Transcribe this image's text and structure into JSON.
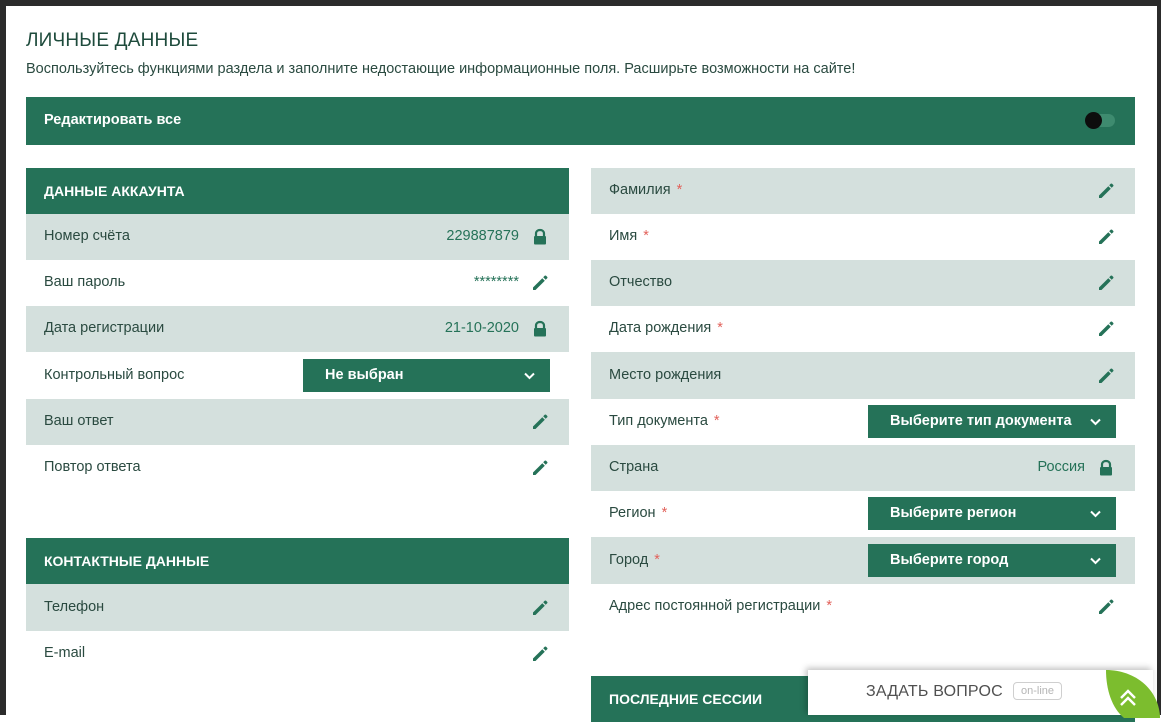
{
  "header": {
    "title": "ЛИЧНЫЕ ДАННЫЕ",
    "subtitle": "Воспользуйтесь функциями раздела и заполните недостающие информационные поля. Расширьте возможности на сайте!"
  },
  "edit_all": {
    "label": "Редактировать все",
    "enabled": false
  },
  "account": {
    "title": "ДАННЫЕ АККАУНТА",
    "account_number": {
      "label": "Номер счёта",
      "value": "229887879",
      "icon": "lock-icon"
    },
    "password": {
      "label": "Ваш пароль",
      "value": "********",
      "icon": "pencil-icon"
    },
    "registration_date": {
      "label": "Дата регистрации",
      "value": "21-10-2020",
      "icon": "lock-icon"
    },
    "security_question": {
      "label": "Контрольный вопрос",
      "selected": "Не выбран"
    },
    "answer": {
      "label": "Ваш ответ",
      "icon": "pencil-icon"
    },
    "answer_repeat": {
      "label": "Повтор ответа",
      "icon": "pencil-icon"
    }
  },
  "contacts": {
    "title": "КОНТАКТНЫЕ ДАННЫЕ",
    "phone": {
      "label": "Телефон",
      "icon": "pencil-icon"
    },
    "email": {
      "label": "E-mail",
      "icon": "pencil-icon"
    }
  },
  "personal": {
    "surname": {
      "label": "Фамилия",
      "required": "*"
    },
    "name": {
      "label": "Имя",
      "required": "*"
    },
    "patronymic": {
      "label": "Отчество"
    },
    "birth_date": {
      "label": "Дата рождения",
      "required": "*"
    },
    "birth_place": {
      "label": "Место рождения"
    },
    "doc_type": {
      "label": "Тип документа",
      "required": "*",
      "selected": "Выберите тип документа"
    },
    "country": {
      "label": "Страна",
      "value": "Россия",
      "icon": "lock-icon"
    },
    "region": {
      "label": "Регион",
      "required": "*",
      "selected": "Выберите регион"
    },
    "city": {
      "label": "Город",
      "required": "*",
      "selected": "Выберите город"
    },
    "address": {
      "label": "Адрес постоянной регистрации",
      "required": "*"
    }
  },
  "sessions": {
    "title": "ПОСЛЕДНИЕ СЕССИИ"
  },
  "ask": {
    "label": "ЗАДАТЬ ВОПРОС",
    "status": "on-line"
  },
  "colors": {
    "brand": "#257258",
    "row_shade": "#d4e0dd",
    "required": "#e2615a",
    "ask_corner": "#7cbd2e"
  }
}
